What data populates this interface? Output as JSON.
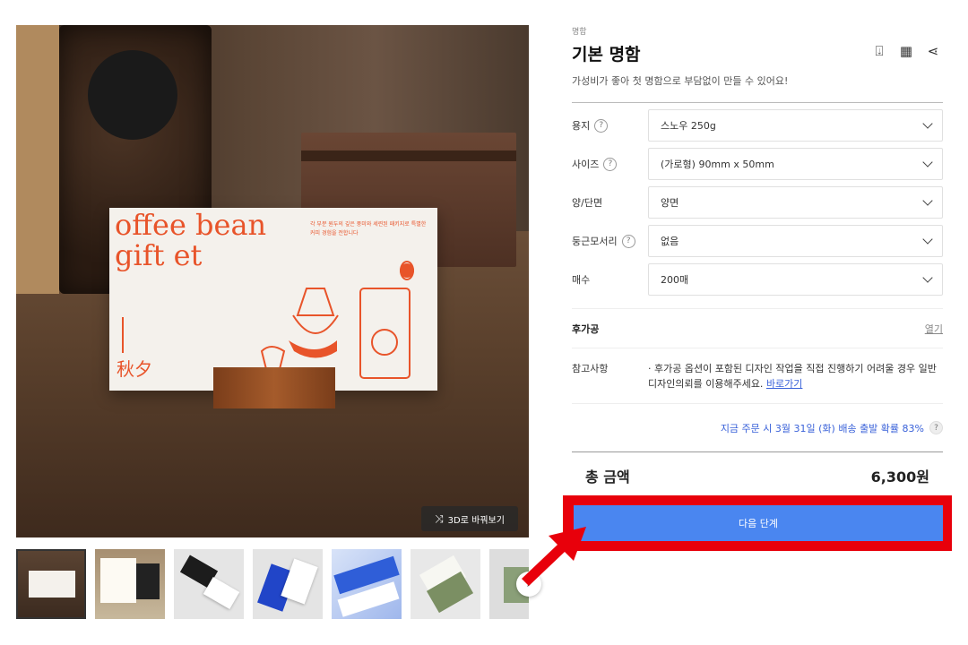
{
  "gallery": {
    "view_3d_label": "3D로 바꿔보기",
    "view_3d_icon": "shuffle-icon",
    "next_icon": "chevron-right-icon",
    "card_text": {
      "title": "offee bean\ngift et",
      "subtitle": "각 부분 원두의 깊은 풍미와 세련된 패키지로 특별한 커피 경험을 전합니다",
      "kanji": "秋夕"
    },
    "thumbnails_count": 7,
    "active_thumbnail": 1
  },
  "product": {
    "category": "명함",
    "title": "기본 명함",
    "description": "가성비가 좋아 첫 명함으로 부담없이 만들 수 있어요!",
    "tools": [
      "download-icon",
      "grid-icon",
      "share-icon"
    ]
  },
  "options": [
    {
      "label": "용지",
      "help": true,
      "value": "스노우 250g"
    },
    {
      "label": "사이즈",
      "help": true,
      "value": "(가로형) 90mm x 50mm"
    },
    {
      "label": "양/단면",
      "help": false,
      "value": "양면"
    },
    {
      "label": "둥근모서리",
      "help": true,
      "value": "없음"
    },
    {
      "label": "매수",
      "help": false,
      "value": "200매"
    }
  ],
  "post_processing": {
    "label": "후가공",
    "action": "열기"
  },
  "note": {
    "label": "참고사항",
    "text": "· 후가공 옵션이 포함된 디자인 작업을 직접 진행하기 어려울 경우 일반 디자인의뢰를 이용해주세요.",
    "link": "바로가기"
  },
  "shipping": {
    "text": "지금 주문 시 3월 31일 (화) 배송 출발 확률 83%"
  },
  "total": {
    "label": "총 금액",
    "value": "6,300원"
  },
  "next": {
    "label": "다음 단계"
  },
  "help_glyph": "?",
  "colors": {
    "accent": "#4a86f0",
    "highlight": "#e8000b",
    "link": "#3a62d9"
  }
}
